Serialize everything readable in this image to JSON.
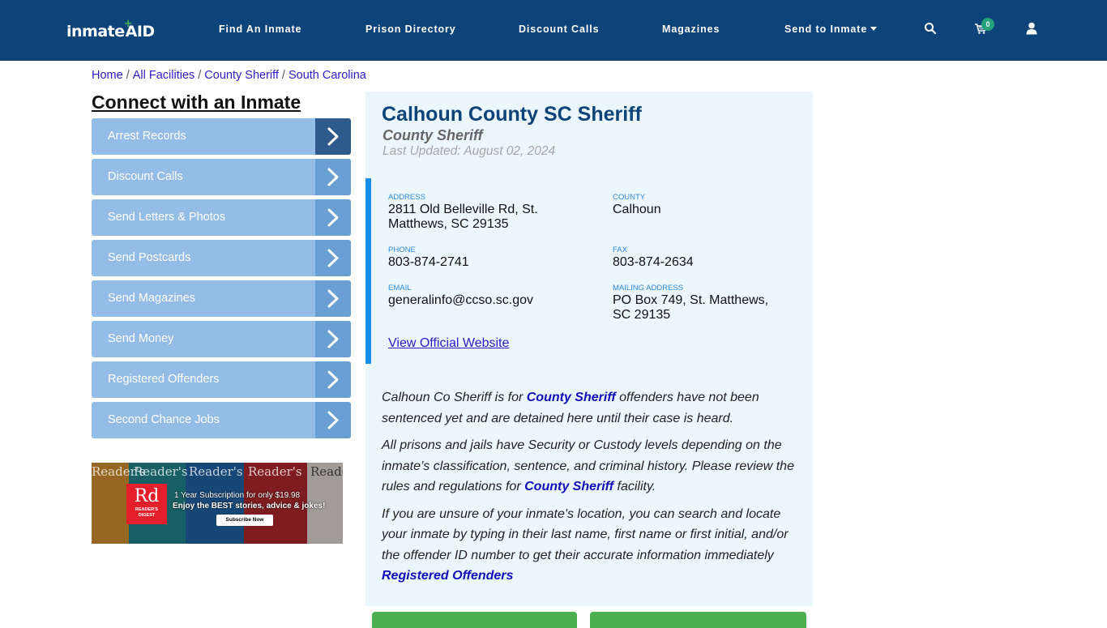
{
  "header": {
    "logo": {
      "part1": "inmate",
      "part2": "AID",
      "plus": "+"
    },
    "nav": [
      {
        "label": "Find An Inmate"
      },
      {
        "label": "Prison Directory"
      },
      {
        "label": "Discount Calls"
      },
      {
        "label": "Magazines"
      },
      {
        "label": "Send to Inmate",
        "has_dropdown": true
      }
    ],
    "icons": [
      "search-icon",
      "cart-icon",
      "user-icon"
    ],
    "cart_count": "0",
    "colors": {
      "background": "#0c4378",
      "badge": "#26a17b"
    }
  },
  "breadcrumb": [
    {
      "label": "Home"
    },
    {
      "label": "All Facilities"
    },
    {
      "label": "County Sheriff"
    },
    {
      "label": "South Carolina"
    }
  ],
  "breadcrumb_separator": "/",
  "sidebar": {
    "title": "Connect with an Inmate",
    "items": [
      {
        "label": "Arrest Records",
        "active": true
      },
      {
        "label": "Discount Calls"
      },
      {
        "label": "Send Letters & Photos"
      },
      {
        "label": "Send Postcards"
      },
      {
        "label": "Send Magazines"
      },
      {
        "label": "Send Money"
      },
      {
        "label": "Registered Offenders"
      },
      {
        "label": "Second Chance Jobs"
      }
    ],
    "ad": {
      "brand_short": "Rd",
      "brand_name": "READER'S DIGEST",
      "masthead": "Reader's",
      "line1": "1 Year Subscription for only $19.98",
      "line2": "Enjoy the BEST stories, advice & jokes!",
      "button": "Subscribe Now"
    }
  },
  "facility": {
    "title": "Calhoun County SC Sheriff",
    "type": "County Sheriff",
    "last_updated": "Last Updated: August 02, 2024",
    "fields": {
      "address": {
        "label": "Address",
        "value": "2811 Old Belleville Rd, St. Matthews, SC 29135"
      },
      "county": {
        "label": "County",
        "value": "Calhoun"
      },
      "phone": {
        "label": "Phone",
        "value": "803-874-2741"
      },
      "fax": {
        "label": "Fax",
        "value": "803-874-2634"
      },
      "email": {
        "label": "Email",
        "value": "generalinfo@ccso.sc.gov"
      },
      "mailing": {
        "label": "Mailing Address",
        "value": "PO Box 749, St. Matthews, SC 29135"
      }
    },
    "website_link": "View Official Website",
    "description": {
      "p1_a": "Calhoun Co Sheriff is for ",
      "p1_link": "County Sheriff",
      "p1_b": " offenders have not been sentenced yet and are detained here until their case is heard.",
      "p2_a": "All prisons and jails have Security or Custody levels depending on the inmate’s classification, sentence, and criminal history. Please review the rules and regulations for ",
      "p2_link": "County Sheriff",
      "p2_b": " facility.",
      "p3": "If you are unsure of your inmate's location, you can search and locate your inmate by typing in their last name, first name or first initial, and/or the offender ID number to get their accurate information immediately",
      "p3_link": "Registered Offenders"
    },
    "colors": {
      "title": "#0c4378",
      "panel_bg": "#ebf6fd",
      "accent_bar": "#1a8fea",
      "green_button": "#4caf50"
    }
  }
}
